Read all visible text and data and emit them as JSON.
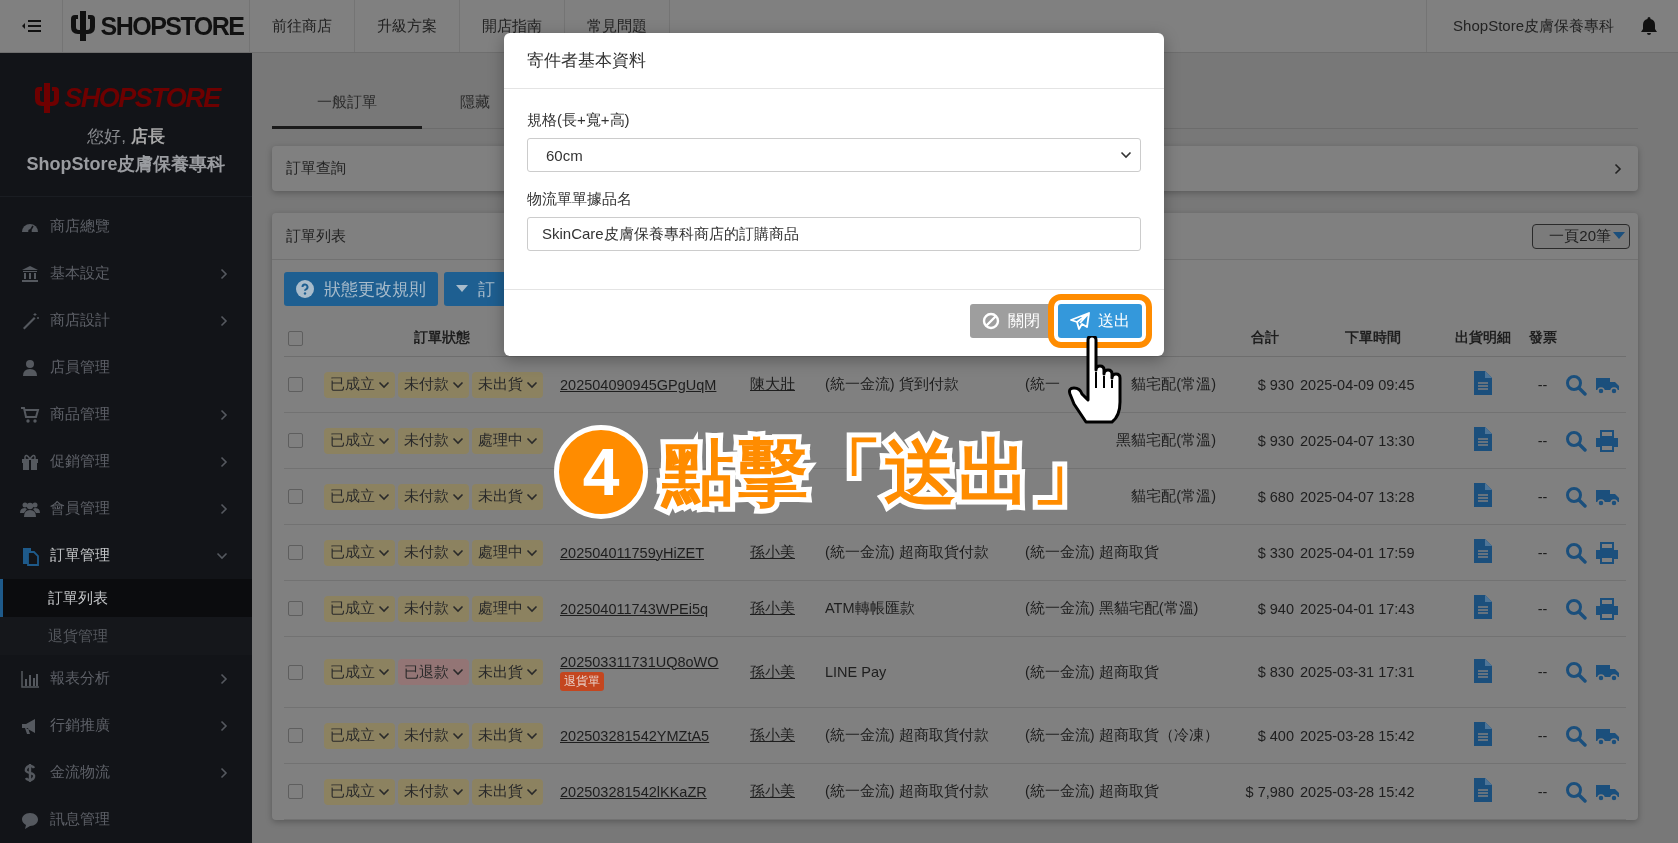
{
  "topbar": {
    "logo": "SHOPSTORE",
    "nav": [
      "前往商店",
      "升級方案",
      "開店指南",
      "常見問題"
    ],
    "store_name": "ShopStore皮膚保養專科"
  },
  "sidebar": {
    "logo": "SHOPSTORE",
    "greeting": "您好, **店長**",
    "store_name": "ShopStore皮膚保養專科",
    "items": [
      {
        "label": "商店總覽",
        "expandable": false,
        "active": false
      },
      {
        "label": "基本設定",
        "expandable": true,
        "expanded": false,
        "active": false
      },
      {
        "label": "商店設計",
        "expandable": true,
        "expanded": false,
        "active": false
      },
      {
        "label": "店員管理",
        "expandable": false,
        "active": false
      },
      {
        "label": "商品管理",
        "expandable": true,
        "expanded": false,
        "active": false
      },
      {
        "label": "促銷管理",
        "expandable": true,
        "expanded": false,
        "active": false
      },
      {
        "label": "會員管理",
        "expandable": true,
        "expanded": false,
        "active": false
      },
      {
        "label": "訂單管理",
        "expandable": true,
        "expanded": true,
        "active": true,
        "children": [
          {
            "label": "訂單列表",
            "selected": true
          },
          {
            "label": "退貨管理",
            "selected": false
          }
        ]
      },
      {
        "label": "報表分析",
        "expandable": true,
        "expanded": false,
        "active": false
      },
      {
        "label": "行銷推廣",
        "expandable": true,
        "expanded": false,
        "active": false
      },
      {
        "label": "金流物流",
        "expandable": true,
        "expanded": false,
        "active": false
      },
      {
        "label": "訊息管理",
        "expandable": false,
        "active": false
      }
    ]
  },
  "tabs": [
    {
      "label": "一般訂單",
      "selected": true
    },
    {
      "label": "隱藏",
      "selected": false
    }
  ],
  "search_panel": {
    "title": "訂單查詢"
  },
  "order_list": {
    "title": "訂單列表",
    "page_size": "一頁20筆",
    "buttons": [
      "狀態更改規則",
      "訂"
    ],
    "select_all_checked": false,
    "columns": [
      "訂單狀態",
      "合計",
      "下單時間",
      "出貨明細",
      "發票"
    ],
    "rows": [
      {
        "checked": false,
        "statuses": [
          {
            "label": "已成立",
            "color": "#8c8260"
          },
          {
            "label": "未付款",
            "color": "#8c8260"
          },
          {
            "label": "未出貨",
            "color": "#8c8260"
          }
        ],
        "order_id": "202504090945GPgUqM",
        "customer": "陳大壯",
        "payment": "(統一金流) 貨到付款",
        "shipping_prefix": "(統一",
        "shipping": "貓宅配(常溫)",
        "total": "$ 930",
        "time": "2025-04-09 09:45",
        "invoice": "--",
        "kind": "truck"
      },
      {
        "checked": false,
        "statuses": [
          {
            "label": "已成立",
            "color": "#8c8260"
          },
          {
            "label": "未付款",
            "color": "#8c8260"
          },
          {
            "label": "處理中",
            "color": "#8c8260"
          }
        ],
        "shipping": "黑貓宅配(常溫)",
        "total": "$ 930",
        "time": "2025-04-07 13:30",
        "invoice": "--",
        "kind": "printer"
      },
      {
        "checked": false,
        "statuses": [
          {
            "label": "已成立",
            "color": "#8c8260"
          },
          {
            "label": "未付款",
            "color": "#8c8260"
          },
          {
            "label": "未出貨",
            "color": "#8c8260"
          }
        ],
        "shipping": "貓宅配(常溫)",
        "total": "$ 680",
        "time": "2025-04-07 13:28",
        "invoice": "--",
        "kind": "truck"
      },
      {
        "checked": false,
        "statuses": [
          {
            "label": "已成立",
            "color": "#8c8260"
          },
          {
            "label": "未付款",
            "color": "#8c8260"
          },
          {
            "label": "處理中",
            "color": "#8c8260"
          }
        ],
        "order_id": "202504011759yHiZET",
        "customer": "孫小美",
        "payment": "(統一金流) 超商取貨付款",
        "shipping": "(統一金流) 超商取貨",
        "total": "$ 330",
        "time": "2025-04-01 17:59",
        "invoice": "--",
        "kind": "printer"
      },
      {
        "checked": false,
        "statuses": [
          {
            "label": "已成立",
            "color": "#8c8260"
          },
          {
            "label": "未付款",
            "color": "#8c8260"
          },
          {
            "label": "處理中",
            "color": "#8c8260"
          }
        ],
        "order_id": "202504011743WPEi5q",
        "customer": "孫小美",
        "payment": "ATM轉帳匯款",
        "shipping": "(統一金流) 黑貓宅配(常溫)",
        "total": "$ 940",
        "time": "2025-04-01 17:43",
        "invoice": "--",
        "kind": "printer"
      },
      {
        "checked": false,
        "statuses": [
          {
            "label": "已成立",
            "color": "#8c8260"
          },
          {
            "label": "已退款",
            "color": "#937575"
          },
          {
            "label": "未出貨",
            "color": "#8c8260"
          }
        ],
        "order_id": "202503311731UQ8oWO",
        "badge": "退貨單",
        "customer": "孫小美",
        "payment": "LINE Pay",
        "shipping": "(統一金流) 超商取貨",
        "total": "$ 830",
        "time": "2025-03-31 17:31",
        "invoice": "--",
        "kind": "truck"
      },
      {
        "checked": false,
        "statuses": [
          {
            "label": "已成立",
            "color": "#8c8260"
          },
          {
            "label": "未付款",
            "color": "#8c8260"
          },
          {
            "label": "未出貨",
            "color": "#8c8260"
          }
        ],
        "order_id": "202503281542YMZtA5",
        "customer": "孫小美",
        "payment": "(統一金流) 超商取貨付款",
        "shipping": "(統一金流) 超商取貨（冷凍）",
        "total": "$ 400",
        "time": "2025-03-28 15:42",
        "invoice": "--",
        "kind": "truck"
      },
      {
        "checked": false,
        "statuses": [
          {
            "label": "已成立",
            "color": "#8c8260"
          },
          {
            "label": "未付款",
            "color": "#8c8260"
          },
          {
            "label": "未出貨",
            "color": "#8c8260"
          }
        ],
        "order_id": "202503281542lKKaZR",
        "customer": "孫小美",
        "payment": "(統一金流) 超商取貨付款",
        "shipping": "(統一金流) 超商取貨",
        "total": "$ 7,980",
        "time": "2025-03-28 15:42",
        "invoice": "--",
        "kind": "truck"
      }
    ]
  },
  "modal": {
    "title": "寄件者基本資料",
    "fields": [
      {
        "kind": "select",
        "label": "規格(長+寬+高)",
        "value": "60cm"
      },
      {
        "kind": "text",
        "label": "物流單單據品名",
        "value": "SkinCare皮膚保養專科商店的訂購商品"
      }
    ],
    "buttons": [
      {
        "kind": "secondary",
        "label": "關閉",
        "highlighted": false
      },
      {
        "kind": "primary",
        "label": "送出",
        "highlighted": true
      }
    ]
  },
  "callout": {
    "step": "4",
    "text": "點擊「送出」"
  }
}
